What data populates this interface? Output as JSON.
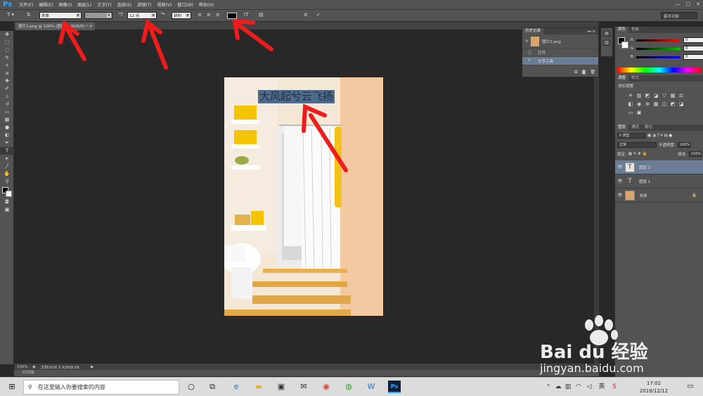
{
  "app": {
    "logo": "Ps"
  },
  "menu": [
    "文件(F)",
    "编辑(E)",
    "图像(I)",
    "图层(L)",
    "文字(Y)",
    "选择(S)",
    "滤镜(T)",
    "视图(V)",
    "窗口(W)",
    "帮助(H)"
  ],
  "options": {
    "font_family": "宋体",
    "font_style": "-",
    "font_size": "12 点",
    "antialias": "锐利",
    "text_color": "#000000",
    "workspace": "基本功能"
  },
  "document": {
    "tab_title": "图片2.png @ 100% (图层 1, RGB/8) *"
  },
  "canvas": {
    "text_layer": "大风起兮云飞扬"
  },
  "status": {
    "zoom": "100%",
    "doc_size": "文档:826.5 K/958.0K",
    "timeline": "时间轴"
  },
  "history": {
    "tabs": [
      "历史记录"
    ],
    "snapshot": "图片2.png",
    "items": [
      "打开",
      "文字工具"
    ]
  },
  "color_panel": {
    "tabs": [
      "颜色",
      "色板"
    ],
    "channels": [
      {
        "label": "R",
        "value": "0",
        "color": "#ff0000"
      },
      {
        "label": "G",
        "value": "0",
        "color": "#00cc00"
      },
      {
        "label": "B",
        "value": "0",
        "color": "#0000ff"
      }
    ]
  },
  "adjust_panel": {
    "tabs": [
      "调整",
      "样式"
    ],
    "title": "添加调整"
  },
  "layers_panel": {
    "tabs": [
      "图层",
      "通道",
      "路径"
    ],
    "kind": "P 类型",
    "blend": "正常",
    "opacity_label": "不透明度:",
    "opacity": "100%",
    "lock_label": "锁定:",
    "fill_label": "填充:",
    "fill": "100%",
    "layers": [
      {
        "name": "图层 2",
        "type": "text",
        "selected": true
      },
      {
        "name": "图层 1",
        "type": "text",
        "selected": false
      },
      {
        "name": "背景",
        "type": "image",
        "selected": false
      }
    ]
  },
  "taskbar": {
    "search_placeholder": "在这里输入你要搜索的内容",
    "time": "17:02",
    "date": "2019/12/12"
  },
  "watermark": {
    "brand": "Bai du 经验",
    "url": "jingyan.baidu.com"
  }
}
